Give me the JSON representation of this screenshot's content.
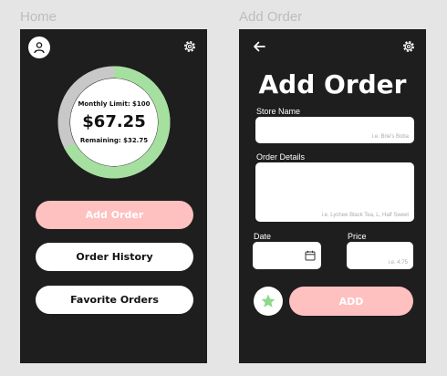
{
  "frames": {
    "home_label": "Home",
    "add_label": "Add Order"
  },
  "home": {
    "icons": {
      "profile": "user-icon",
      "settings": "gear-icon"
    },
    "budget": {
      "limit_text": "Monthly Limit: $100",
      "amount_text": "$67.25",
      "remaining_text": "Remaining: $32.75",
      "spent_fraction": 0.6725,
      "colors": {
        "ring_remaining": "#a6e0a0",
        "ring_spent": "#c8c8c8"
      }
    },
    "buttons": {
      "add_order": "Add Order",
      "order_history": "Order History",
      "favorite_orders": "Favorite Orders"
    }
  },
  "add_order": {
    "title": "Add Order",
    "icons": {
      "back": "arrow-left-icon",
      "settings": "gear-icon",
      "calendar": "calendar-icon",
      "favorite": "star-icon"
    },
    "store": {
      "label": "Store Name",
      "placeholder": "i.e. Brie's Boba"
    },
    "details": {
      "label": "Order Details",
      "placeholder": "i.e. Lychee Black Tea, L, Half Sweet"
    },
    "date": {
      "label": "Date"
    },
    "price": {
      "label": "Price",
      "placeholder": "i.e. 4.75"
    },
    "submit_label": "ADD",
    "colors": {
      "accent_pink": "#ffc0c0",
      "star_green": "#8fd98a"
    }
  }
}
